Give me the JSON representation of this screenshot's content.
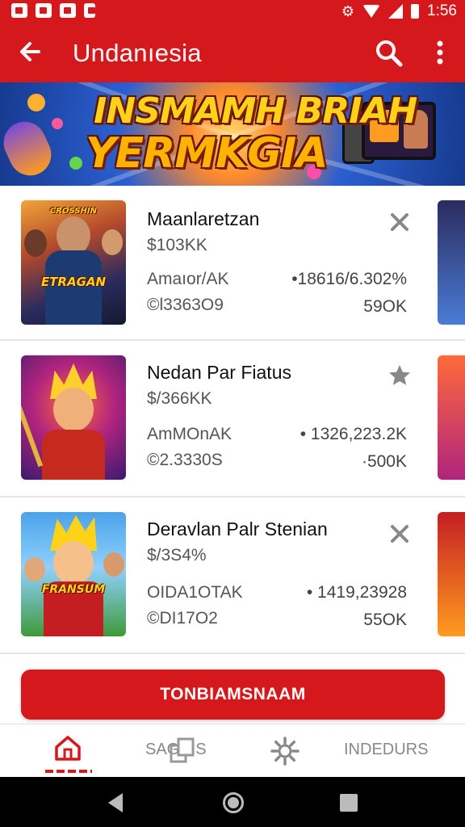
{
  "app": {
    "title": "Undanıesia"
  },
  "status_bar": {
    "time": "1:56"
  },
  "banner": {
    "line1": "INSMAMH BRIAH",
    "line2": "YERMKGIA"
  },
  "items": [
    {
      "name": "Maanlaretzan",
      "price": "$103KK",
      "meta_left_1": "Amaıor/AK",
      "meta_left_2": "©l3363O9",
      "meta_right_1": "•18616/6.302%",
      "meta_right_2": "59OK",
      "thumb_top": "CROSSHIN",
      "thumb_mid": "ETRAGAN"
    },
    {
      "name": "Nedan Par Fiatus",
      "price": "$/366KK",
      "meta_left_1": "AmMOnAK",
      "meta_left_2": "©2.3330S",
      "meta_right_1": "• 1326,223.2K",
      "meta_right_2": "·500K",
      "thumb_top": "",
      "thumb_mid": ""
    },
    {
      "name": "Deravlan Palr Stenian",
      "price": "$/3S4%",
      "meta_left_1": "OIDA1OTAK",
      "meta_left_2": "©DI17O2",
      "meta_right_1": "• 1419,23928",
      "meta_right_2": "55OK",
      "thumb_top": "",
      "thumb_mid": "FRANSUM"
    }
  ],
  "cta": {
    "label": "TONBIAMSNAAM"
  },
  "bottom_nav": {
    "item2": "SAGINS",
    "item4": "INDEDURS"
  },
  "colors": {
    "accent": "#d4181c"
  }
}
